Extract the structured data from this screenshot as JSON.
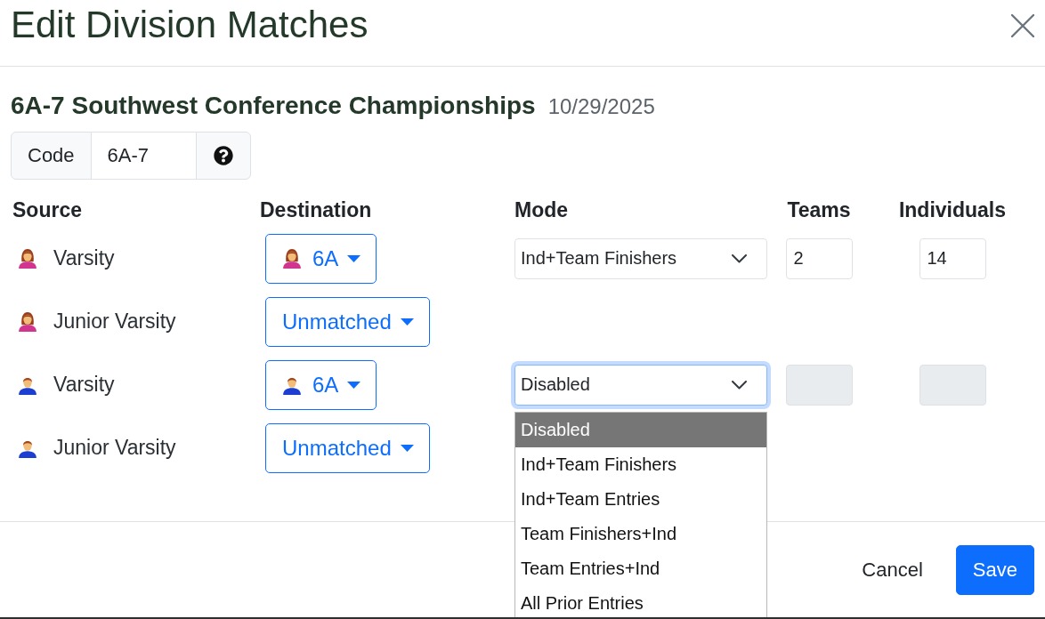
{
  "dialog": {
    "title": "Edit Division Matches"
  },
  "meet": {
    "name": "6A-7 Southwest Conference Championships",
    "date": "10/29/2025"
  },
  "code_field": {
    "label": "Code",
    "value": "6A-7"
  },
  "columns": [
    "Source",
    "Destination",
    "Mode",
    "Teams",
    "Individuals"
  ],
  "rows": [
    {
      "source": {
        "label": "Varsity",
        "kind": "female"
      },
      "destination": {
        "label": "6A",
        "kind": "female"
      },
      "mode": {
        "value": "Ind+Team Finishers",
        "focused": false
      },
      "teams": {
        "value": "2",
        "disabled": false
      },
      "individuals": {
        "value": "14",
        "disabled": false
      }
    },
    {
      "source": {
        "label": "Junior Varsity",
        "kind": "female"
      },
      "destination": {
        "label": "Unmatched"
      }
    },
    {
      "source": {
        "label": "Varsity",
        "kind": "male"
      },
      "destination": {
        "label": "6A",
        "kind": "male"
      },
      "mode": {
        "value": "Disabled",
        "focused": true,
        "options": [
          {
            "label": "Disabled",
            "selected": true
          },
          {
            "label": "Ind+Team Finishers",
            "selected": false
          },
          {
            "label": "Ind+Team Entries",
            "selected": false
          },
          {
            "label": "Team Finishers+Ind",
            "selected": false
          },
          {
            "label": "Team Entries+Ind",
            "selected": false
          },
          {
            "label": "All Prior Entries",
            "selected": false
          }
        ]
      },
      "teams": {
        "disabled": true
      },
      "individuals": {
        "disabled": true
      }
    },
    {
      "source": {
        "label": "Junior Varsity",
        "kind": "male"
      },
      "destination": {
        "label": "Unmatched"
      }
    }
  ],
  "footer": {
    "buttons": [
      {
        "label": "Cancel",
        "kind": "link"
      },
      {
        "label": "Save",
        "kind": "primary"
      }
    ]
  }
}
